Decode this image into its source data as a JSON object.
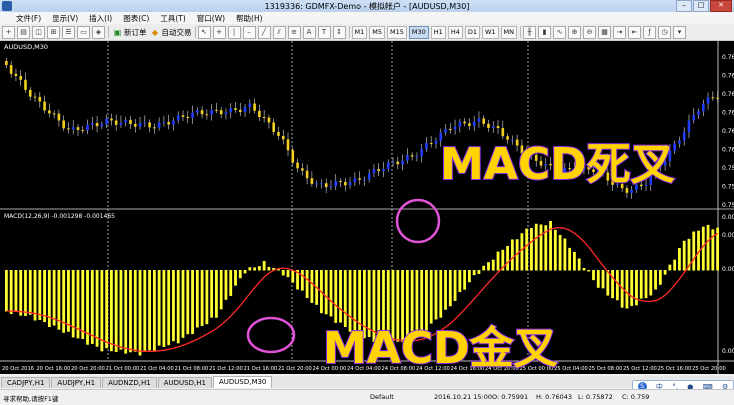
{
  "window": {
    "title": "1319336: GDMFX-Demo - 模拟帐户 - [AUDUSD,M30]"
  },
  "menu": [
    "文件(F)",
    "显示(V)",
    "插入(I)",
    "图表(C)",
    "工具(T)",
    "窗口(W)",
    "帮助(H)"
  ],
  "toolbar": {
    "new_order": "新订单",
    "auto_trade": "自动交易",
    "timeframes": [
      "M1",
      "M5",
      "M15",
      "M30",
      "H1",
      "H4",
      "D1",
      "W1",
      "MN"
    ],
    "active_tf": "M30"
  },
  "chart": {
    "symbol_label": "AUDUSD,M30",
    "indicator_label": "MACD(12,26,9) -0.001298 -0.001465",
    "price_ticks": [
      "0.76",
      "0.76",
      "0.76",
      "0.76",
      "0.76",
      "0.76",
      "0.75",
      "0.75",
      "0.75"
    ],
    "macd_ticks": [
      "0.00",
      "0.00",
      "0.00",
      "0.00"
    ],
    "time_labels": [
      "20 Oct 2016",
      "20 Oct 16:00",
      "20 Oct 20:00",
      "21 Oct 00:00",
      "21 Oct 04:00",
      "21 Oct 08:00",
      "21 Oct 12:00",
      "21 Oct 16:00",
      "21 Oct 20:00",
      "24 Oct 00:00",
      "24 Oct 04:00",
      "24 Oct 08:00",
      "24 Oct 12:00",
      "24 Oct 16:00",
      "24 Oct 20:00",
      "25 Oct 00:00",
      "25 Oct 04:00",
      "25 Oct 08:00",
      "25 Oct 12:00",
      "25 Oct 16:00",
      "25 Oct 20:00"
    ],
    "annotation_dead_cross": "MACD死叉",
    "annotation_golden_cross": "MACD金叉",
    "colors": {
      "up_candle": "#1f3cff",
      "down_candle": "#f2d01c",
      "histogram": "#ffff33",
      "signal_line": "#ff2a2a",
      "circle": "#e053d6",
      "annotation_text": "#ffd400",
      "annotation_outline": "#8a2be2"
    }
  },
  "tabs": [
    {
      "label": "CADJPY,H1",
      "active": false
    },
    {
      "label": "AUDJPY,H1",
      "active": false
    },
    {
      "label": "AUDNZD,H1",
      "active": false
    },
    {
      "label": "AUDUSD,H1",
      "active": false
    },
    {
      "label": "AUDUSD,M30",
      "active": true
    }
  ],
  "status": {
    "help": "寻求帮助,请按F1键",
    "profile": "Default",
    "datetime": "2016.10.21 15:00",
    "open": "O: 0.75991",
    "high": "H: 0.76043",
    "low": "L: 0.75872",
    "close": "C: 0.759"
  },
  "ime": {
    "lang": "中",
    "punct": "°,",
    "icon": "S"
  }
}
